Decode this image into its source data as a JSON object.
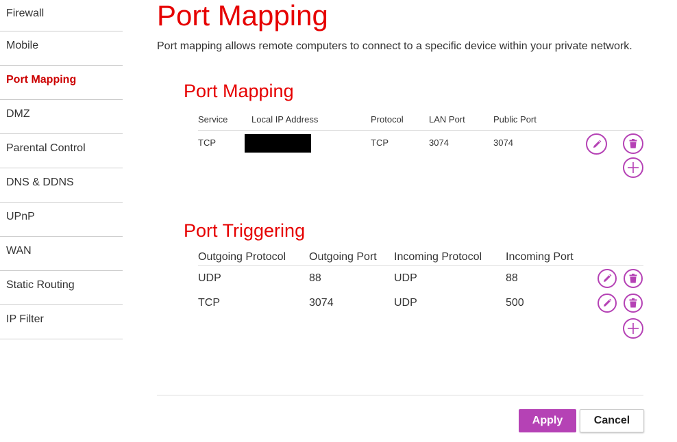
{
  "sidebar": {
    "items": [
      {
        "label": "Firewall"
      },
      {
        "label": "Mobile"
      },
      {
        "label": "Port Mapping",
        "active": true
      },
      {
        "label": "DMZ"
      },
      {
        "label": "Parental Control"
      },
      {
        "label": "DNS & DDNS"
      },
      {
        "label": "UPnP"
      },
      {
        "label": "WAN"
      },
      {
        "label": "Static Routing"
      },
      {
        "label": "IP Filter"
      }
    ]
  },
  "main": {
    "title": "Port Mapping",
    "description": "Port mapping allows remote computers to connect to a specific device within your private network."
  },
  "port_mapping": {
    "title": "Port Mapping",
    "headers": [
      "Service",
      "Local IP Address",
      "Protocol",
      "LAN Port",
      "Public Port"
    ],
    "rows": [
      {
        "service": "TCP",
        "local_ip": "",
        "protocol": "TCP",
        "lan_port": "3074",
        "public_port": "3074"
      }
    ]
  },
  "port_triggering": {
    "title": "Port Triggering",
    "headers": [
      "Outgoing Protocol",
      "Outgoing Port",
      "Incoming Protocol",
      "Incoming Port"
    ],
    "rows": [
      {
        "outgoing_protocol": "UDP",
        "outgoing_port": "88",
        "incoming_protocol": "UDP",
        "incoming_port": "88"
      },
      {
        "outgoing_protocol": "TCP",
        "outgoing_port": "3074",
        "incoming_protocol": "UDP",
        "incoming_port": "500"
      }
    ]
  },
  "icons": {
    "edit": "pencil-icon",
    "delete": "trash-icon",
    "add": "plus-icon"
  },
  "colors": {
    "accent_red": "#e60000",
    "accent_purple": "#b542b5"
  },
  "actions": {
    "apply_label": "Apply",
    "cancel_label": "Cancel"
  }
}
